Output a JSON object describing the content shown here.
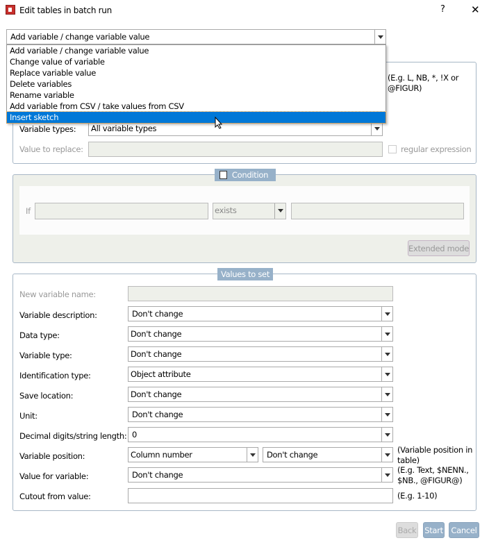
{
  "window": {
    "title": "Edit tables in batch run",
    "help": "?",
    "close": "✕"
  },
  "action": {
    "selected": "Add variable / change variable value",
    "options": [
      "Add variable / change variable value",
      "Change value of variable",
      "Replace variable value",
      "Delete variables",
      "Rename variable",
      "Add variable from CSV / take values from CSV",
      "Insert sketch"
    ],
    "highlighted_index": 6
  },
  "filter": {
    "note": "(E.g. L, NB, *, !X or @FIGUR)",
    "variable_types_label": "Variable types:",
    "variable_types_value": "All variable types",
    "value_to_replace_label": "Value to replace:",
    "value_to_replace": "",
    "regex_label": "regular expression",
    "regex_checked": false
  },
  "condition": {
    "title": "Condition",
    "checked": false,
    "if_label": "If",
    "operator": "exists",
    "extended_mode": "Extended mode"
  },
  "values": {
    "title": "Values to set",
    "new_variable_name_label": "New variable name:",
    "rows": [
      {
        "label": "Variable description:",
        "value": "Don't change"
      },
      {
        "label": "Data type:",
        "value": "Don't change"
      },
      {
        "label": "Variable type:",
        "value": "Don't change"
      },
      {
        "label": "Identification type:",
        "value": "Object attribute"
      },
      {
        "label": "Save location:",
        "value": "Don't change"
      },
      {
        "label": "Unit:",
        "value": "Don't change"
      },
      {
        "label": "Decimal digits/string length:",
        "value": "0"
      }
    ],
    "position_label": "Variable position:",
    "position_mode": "Column number",
    "position_value": "Don't change",
    "position_note": "(Variable position in table)",
    "value_label": "Value for variable:",
    "value_value": "Don't change",
    "value_note": "(E.g. Text, $NENN., $NB., @FIGUR@)",
    "cutout_label": "Cutout from value:",
    "cutout_value": "",
    "cutout_note": "(E.g. 1-10)"
  },
  "buttons": {
    "back": "Back",
    "start": "Start",
    "cancel": "Cancel"
  }
}
